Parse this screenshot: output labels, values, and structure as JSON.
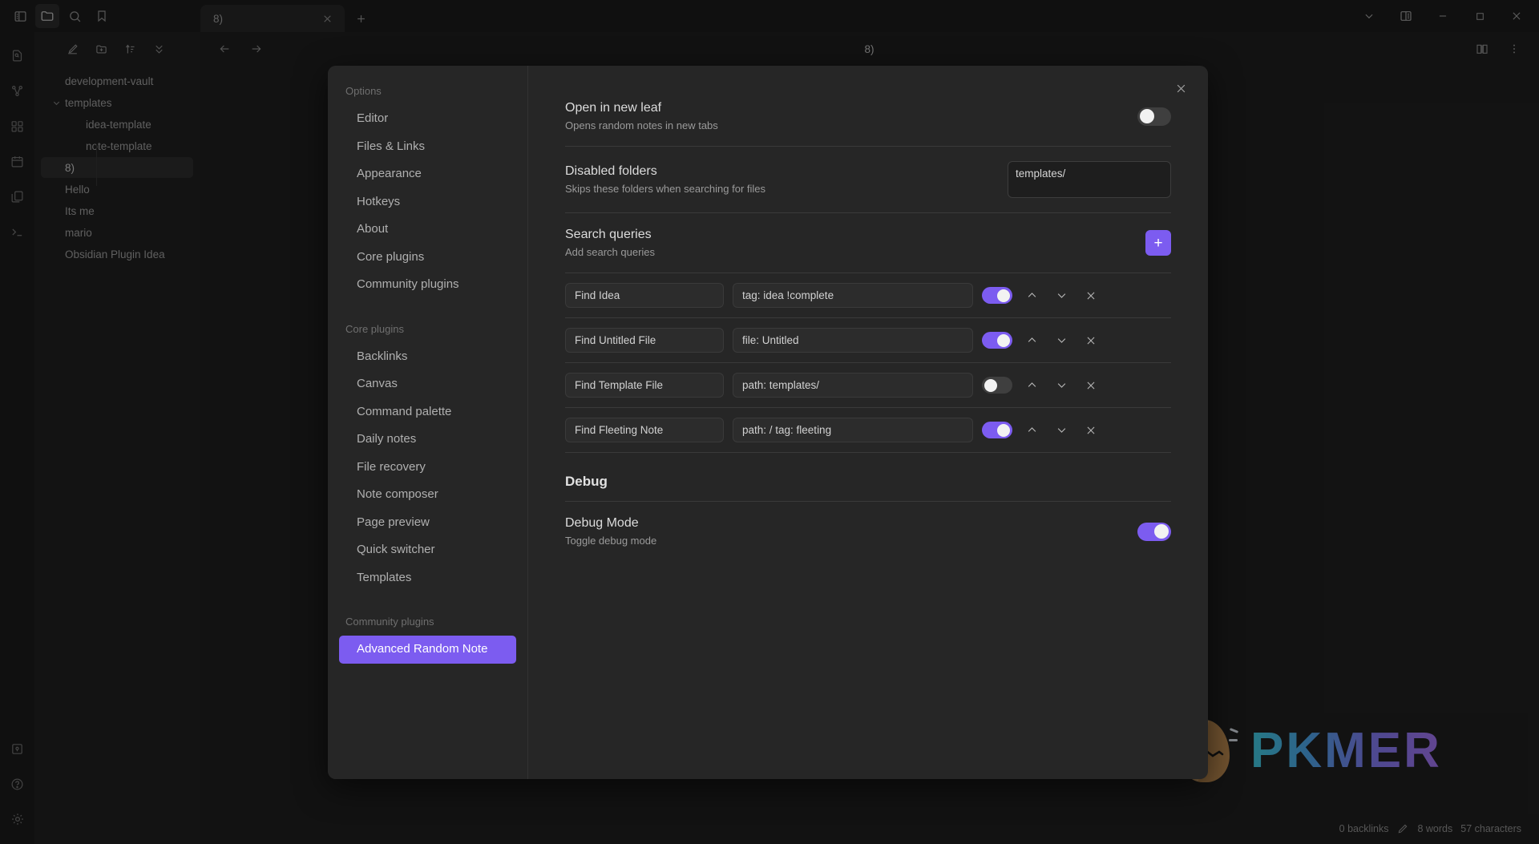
{
  "window": {
    "tab_title": "8)",
    "editor_title": "8)",
    "controls": [
      {
        "name": "chevron-down-icon"
      },
      {
        "name": "split-layout-icon"
      },
      {
        "name": "minimize-icon"
      },
      {
        "name": "maximize-icon"
      },
      {
        "name": "close-icon"
      }
    ]
  },
  "ribbon_top": [
    {
      "name": "toggle-left-sidebar-icon",
      "active": false
    },
    {
      "name": "folder-icon",
      "active": true
    },
    {
      "name": "search-icon",
      "active": false
    },
    {
      "name": "bookmark-icon",
      "active": false
    }
  ],
  "ribbon_left": [
    {
      "name": "file-search-icon"
    },
    {
      "name": "graph-icon"
    },
    {
      "name": "canvas-icon"
    },
    {
      "name": "calendar-icon"
    },
    {
      "name": "copy-icon"
    },
    {
      "name": "terminal-icon"
    },
    {
      "name": "vault-icon"
    },
    {
      "name": "help-icon"
    },
    {
      "name": "settings-gear-icon"
    }
  ],
  "explorer": {
    "toolbar": [
      {
        "name": "new-note-icon"
      },
      {
        "name": "new-folder-icon"
      },
      {
        "name": "sort-icon"
      },
      {
        "name": "collapse-all-icon"
      }
    ],
    "tree": [
      {
        "label": "development-vault",
        "type": "vault",
        "depth": 0,
        "selected": false,
        "expandable": false
      },
      {
        "label": "templates",
        "type": "folder",
        "depth": 0,
        "selected": false,
        "expandable": true
      },
      {
        "label": "idea-template",
        "type": "file",
        "depth": 1,
        "selected": false,
        "expandable": false
      },
      {
        "label": "note-template",
        "type": "file",
        "depth": 1,
        "selected": false,
        "expandable": false
      },
      {
        "label": "8)",
        "type": "file",
        "depth": 0,
        "selected": true,
        "expandable": false
      },
      {
        "label": "Hello",
        "type": "file",
        "depth": 0,
        "selected": false,
        "expandable": false
      },
      {
        "label": "Its me",
        "type": "file",
        "depth": 0,
        "selected": false,
        "expandable": false
      },
      {
        "label": "mario",
        "type": "file",
        "depth": 0,
        "selected": false,
        "expandable": false
      },
      {
        "label": "Obsidian Plugin Idea",
        "type": "file",
        "depth": 0,
        "selected": false,
        "expandable": false
      }
    ]
  },
  "statusbar": {
    "backlinks": "0 backlinks",
    "words": "8 words",
    "characters": "57 characters"
  },
  "watermark": {
    "text": "PKMER"
  },
  "settings_modal": {
    "close_label": "×",
    "nav": {
      "groups": [
        {
          "title": "Options",
          "items": [
            {
              "label": "Editor",
              "active": false
            },
            {
              "label": "Files & Links",
              "active": false
            },
            {
              "label": "Appearance",
              "active": false
            },
            {
              "label": "Hotkeys",
              "active": false
            },
            {
              "label": "About",
              "active": false
            },
            {
              "label": "Core plugins",
              "active": false
            },
            {
              "label": "Community plugins",
              "active": false
            }
          ]
        },
        {
          "title": "Core plugins",
          "items": [
            {
              "label": "Backlinks",
              "active": false
            },
            {
              "label": "Canvas",
              "active": false
            },
            {
              "label": "Command palette",
              "active": false
            },
            {
              "label": "Daily notes",
              "active": false
            },
            {
              "label": "File recovery",
              "active": false
            },
            {
              "label": "Note composer",
              "active": false
            },
            {
              "label": "Page preview",
              "active": false
            },
            {
              "label": "Quick switcher",
              "active": false
            },
            {
              "label": "Templates",
              "active": false
            }
          ]
        },
        {
          "title": "Community plugins",
          "items": [
            {
              "label": "Advanced Random Note",
              "active": true
            }
          ]
        }
      ]
    },
    "open_in_new_leaf": {
      "name": "Open in new leaf",
      "desc": "Opens random notes in new tabs",
      "enabled": false
    },
    "disabled_folders": {
      "name": "Disabled folders",
      "desc": "Skips these folders when searching for files",
      "value": "templates/"
    },
    "search_queries": {
      "name": "Search queries",
      "desc": "Add search queries",
      "add_label": "+",
      "rows": [
        {
          "name": "Find Idea",
          "query": "tag: idea !complete",
          "enabled": true
        },
        {
          "name": "Find Untitled File",
          "query": "file: Untitled",
          "enabled": true
        },
        {
          "name": "Find Template File",
          "query": "path: templates/",
          "enabled": false
        },
        {
          "name": "Find Fleeting Note",
          "query": "path: / tag: fleeting",
          "enabled": true
        }
      ]
    },
    "debug": {
      "heading": "Debug",
      "mode": {
        "name": "Debug Mode",
        "desc": "Toggle debug mode",
        "enabled": true
      }
    }
  },
  "colors": {
    "accent": "#7c5cf0",
    "bg": "#1e1e1e",
    "modal_bg": "#262626"
  }
}
